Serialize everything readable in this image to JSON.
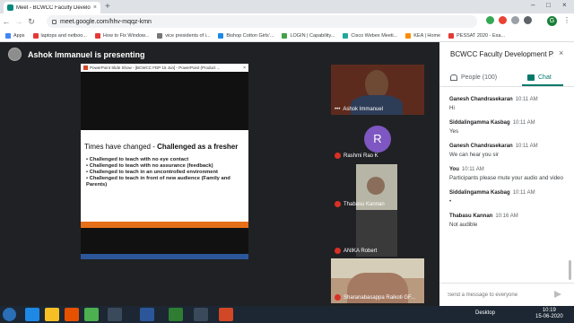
{
  "browser": {
    "tab_title": "Meet - BCWCC Faculty Develo",
    "url": "meet.google.com/hhv-mqqz-kmn",
    "profile_initial": "G",
    "bookmarks": [
      {
        "label": "Apps",
        "color": "#4285f4"
      },
      {
        "label": "laptops and netboo...",
        "color": "#e53935"
      },
      {
        "label": "How to Fix Window...",
        "color": "#e53935"
      },
      {
        "label": "vice presidents of i...",
        "color": "#757575"
      },
      {
        "label": "Bishop Cotton Girls'...",
        "color": "#1e88e5"
      },
      {
        "label": "LOGIN | Capability...",
        "color": "#43a047"
      },
      {
        "label": "Cisco Webex Meeti...",
        "color": "#26a69a"
      },
      {
        "label": "KEA | Home",
        "color": "#fb8c00"
      },
      {
        "label": "PESSAT 2020 - Exa...",
        "color": "#e53935"
      }
    ]
  },
  "meet": {
    "presenting_text": "Ashok Immanuel is presenting",
    "slide_window_title": "PowerPoint Slide Show - [BCWCC FDP 15 Jun] - PowerPoint (Product ...",
    "slide": {
      "heading_left": "Times have changed",
      "heading_dash": " - ",
      "heading_right": "Challenged as a fresher",
      "bullets": [
        "Challenged to teach with no eye contact",
        "Challenged to teach with no assurance (feedback)",
        "Challenged to teach in an uncontrolled environment",
        "Challenged to teach in front of new audience (Family and Parents)"
      ]
    },
    "tiles": [
      {
        "name": "Ashok Immanuel"
      },
      {
        "name": "Rashmi Rao K",
        "initial": "R"
      },
      {
        "name": "Thabasu Kannan"
      },
      {
        "name": "ANIKA Robert"
      },
      {
        "name": "Sharanabasappa Raikoti GF..."
      }
    ]
  },
  "side_panel": {
    "title": "BCWCC Faculty Development P...",
    "people_label": "People (100)",
    "chat_label": "Chat",
    "messages": [
      {
        "sender": "Ganesh Chandrasekaran",
        "time": "10:11 AM",
        "text": "Hi"
      },
      {
        "sender": "Siddalingamma Kasbag",
        "time": "10:11 AM",
        "text": "Yes"
      },
      {
        "sender": "Ganesh Chandrasekaran",
        "time": "10:11 AM",
        "text": "We can hear you sir"
      },
      {
        "sender": "You",
        "time": "10:11 AM",
        "text": "Participants please mute your audio and video"
      },
      {
        "sender": "Siddalingamma Kasbag",
        "time": "10:11 AM",
        "text": "•"
      },
      {
        "sender": "Thabasu Kannan",
        "time": "10:16 AM",
        "text": "Not audible"
      }
    ],
    "compose_placeholder": "Send a message to everyone"
  },
  "taskbar": {
    "desktop_label": "Desktop",
    "time": "10:19",
    "date": "15-06-2020",
    "apps": [
      {
        "name": "ie",
        "color": "#1e88e5"
      },
      {
        "name": "explorer",
        "color": "#f6bf26"
      },
      {
        "name": "media",
        "color": "#e65100"
      },
      {
        "name": "chrome",
        "color": "#4caf50"
      },
      {
        "name": "word",
        "color": "#2b579a"
      },
      {
        "name": "check",
        "color": "#2e7d32"
      },
      {
        "name": "powerpoint",
        "color": "#d24726"
      }
    ]
  }
}
